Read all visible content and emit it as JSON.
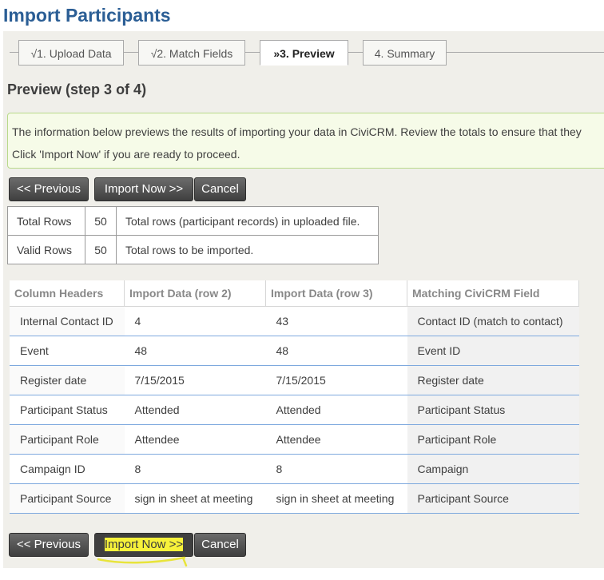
{
  "page": {
    "title": "Import Participants"
  },
  "wizard": {
    "steps": [
      {
        "label": "√1. Upload Data"
      },
      {
        "label": "√2. Match Fields"
      },
      {
        "label": "»3. Preview"
      },
      {
        "label": "4. Summary"
      }
    ],
    "active_step": 3
  },
  "step_title": "Preview (step 3 of 4)",
  "help": {
    "line1": "The information below previews the results of importing your data in CiviCRM. Review the totals to ensure that they",
    "line2": "Click 'Import Now' if you are ready to proceed."
  },
  "buttons": {
    "previous": "<< Previous",
    "import": "Import Now >>",
    "cancel": "Cancel"
  },
  "summary": [
    {
      "label": "Total Rows",
      "value": "50",
      "desc": "Total rows (participant records) in uploaded file."
    },
    {
      "label": "Valid Rows",
      "value": "50",
      "desc": "Total rows to be imported."
    }
  ],
  "preview": {
    "headers": [
      "Column Headers",
      "Import Data (row 2)",
      "Import Data (row 3)",
      "Matching CiviCRM Field"
    ],
    "rows": [
      [
        "Internal Contact ID",
        "4",
        "43",
        "Contact ID (match to contact)"
      ],
      [
        "Event",
        "48",
        "48",
        "Event ID"
      ],
      [
        "Register date",
        "7/15/2015",
        "7/15/2015",
        "Register date"
      ],
      [
        "Participant Status",
        "Attended",
        "Attended",
        "Participant Status"
      ],
      [
        "Participant Role",
        "Attendee",
        "Attendee",
        "Participant Role"
      ],
      [
        "Campaign ID",
        "8",
        "8",
        "Campaign"
      ],
      [
        "Participant Source",
        "sign in sheet at meeting",
        "sign in sheet at meeting",
        "Participant Source"
      ]
    ]
  },
  "colors": {
    "title": "#2b5e95",
    "highlight": "#f7f23a",
    "button": "#4a4a4a"
  }
}
